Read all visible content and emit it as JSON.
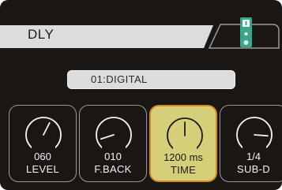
{
  "header": {
    "effect_name": "DLY",
    "pedal_icon": "pedal-icon",
    "pedal_color": "#3aa68a"
  },
  "preset": {
    "label": "01:DIGITAL"
  },
  "knobs": [
    {
      "label": "LEVEL",
      "value": "060",
      "level": 0.6,
      "selected": false
    },
    {
      "label": "F.BACK",
      "value": "010",
      "level": 0.1,
      "selected": false
    },
    {
      "label": "TIME",
      "value": "1200 ms",
      "level": 0.5,
      "selected": true
    },
    {
      "label": "SUB-D",
      "value": "1/4",
      "level": 0.85,
      "selected": false
    }
  ],
  "colors": {
    "background": "#1a1614",
    "header_bar": "#dcdcdc",
    "selected_fill": "#d4cf78",
    "selected_border": "#d58a19",
    "knob_border": "#9a9a9a"
  }
}
